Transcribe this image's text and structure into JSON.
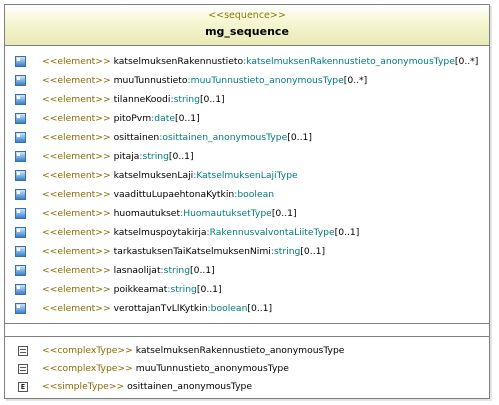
{
  "stereotype": "<<sequence>>",
  "title": "mg_sequence",
  "elements": [
    {
      "stereo": "<<element>>",
      "name": "katselmuksenRakennustieto",
      "sep": ":",
      "type": "katselmuksenRakennustieto_anonymousType",
      "mult": "[0..*]"
    },
    {
      "stereo": "<<element>>",
      "name": "muuTunnustieto",
      "sep": ":",
      "type": "muuTunnustieto_anonymousType",
      "mult": "[0..*]"
    },
    {
      "stereo": "<<element>>",
      "name": "tilanneKoodi",
      "sep": ":",
      "type": "string",
      "mult": "[0..1]"
    },
    {
      "stereo": "<<element>>",
      "name": "pitoPvm",
      "sep": ":",
      "type": "date",
      "mult": "[0..1]"
    },
    {
      "stereo": "<<element>>",
      "name": "osittainen",
      "sep": ":",
      "type": "osittainen_anonymousType",
      "mult": "[0..1]"
    },
    {
      "stereo": "<<element>>",
      "name": "pitaja",
      "sep": ":",
      "type": "string",
      "mult": "[0..1]"
    },
    {
      "stereo": "<<element>>",
      "name": "katselmuksenLaji",
      "sep": ":",
      "type": "KatselmuksenLajiType",
      "mult": ""
    },
    {
      "stereo": "<<element>>",
      "name": "vaadittuLupaehtonaKytkin",
      "sep": ":",
      "type": "boolean",
      "mult": ""
    },
    {
      "stereo": "<<element>>",
      "name": "huomautukset",
      "sep": ":",
      "type": "HuomautuksetType",
      "mult": "[0..1]"
    },
    {
      "stereo": "<<element>>",
      "name": "katselmuspoytakirja",
      "sep": ":",
      "type": "RakennusvalvontaLiiteType",
      "mult": "[0..1]"
    },
    {
      "stereo": "<<element>>",
      "name": "tarkastuksenTaiKatselmuksenNimi",
      "sep": ":",
      "type": "string",
      "mult": "[0..1]"
    },
    {
      "stereo": "<<element>>",
      "name": "lasnaolijat",
      "sep": ":",
      "type": "string",
      "mult": "[0..1]"
    },
    {
      "stereo": "<<element>>",
      "name": "poikkeamat",
      "sep": ":",
      "type": "string",
      "mult": "[0..1]"
    },
    {
      "stereo": "<<element>>",
      "name": "verottajanTvLlKytkin",
      "sep": ":",
      "type": "boolean",
      "mult": "[0..1]"
    }
  ],
  "nested_types": [
    {
      "icon": "complex-type-icon",
      "stereo": "<<complexType>>",
      "name": "katselmuksenRakennustieto_anonymousType"
    },
    {
      "icon": "complex-type-icon",
      "stereo": "<<complexType>>",
      "name": "muuTunnustieto_anonymousType"
    },
    {
      "icon": "simple-type-icon",
      "stereo": "<<simpleType>>",
      "name": "osittainen_anonymousType",
      "icon_glyph": "E"
    }
  ]
}
